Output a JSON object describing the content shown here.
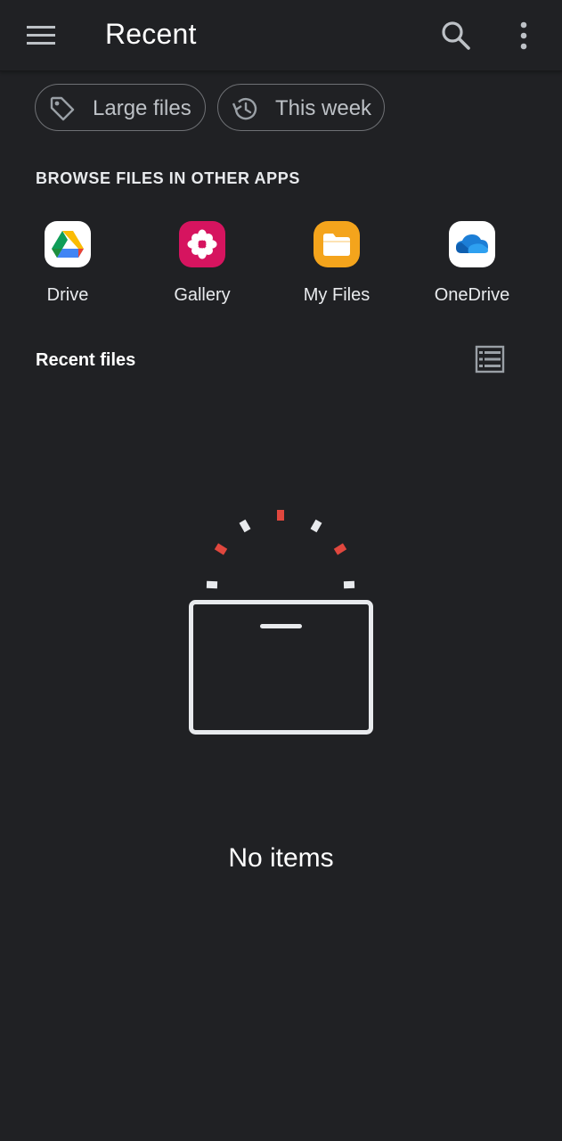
{
  "header": {
    "title": "Recent",
    "menu_icon": "hamburger-menu-icon",
    "search_icon": "search-icon",
    "more_icon": "more-vertical-icon"
  },
  "filters": [
    {
      "label": "Large files",
      "icon": "tag-icon"
    },
    {
      "label": "This week",
      "icon": "history-icon"
    }
  ],
  "browse": {
    "title": "BROWSE FILES IN OTHER APPS",
    "apps": [
      {
        "label": "Drive",
        "icon": "google-drive-icon"
      },
      {
        "label": "Gallery",
        "icon": "gallery-flower-icon",
        "color": "#d6145f"
      },
      {
        "label": "My Files",
        "icon": "folder-icon",
        "color": "#f4a41c"
      },
      {
        "label": "OneDrive",
        "icon": "onedrive-cloud-icon",
        "color": "#1c7ed6"
      }
    ]
  },
  "recent": {
    "title": "Recent files",
    "view_icon": "list-view-icon",
    "empty_text": "No items"
  },
  "colors": {
    "background": "#202124",
    "accent_red": "#e0473e",
    "outline": "#e8eaed"
  }
}
